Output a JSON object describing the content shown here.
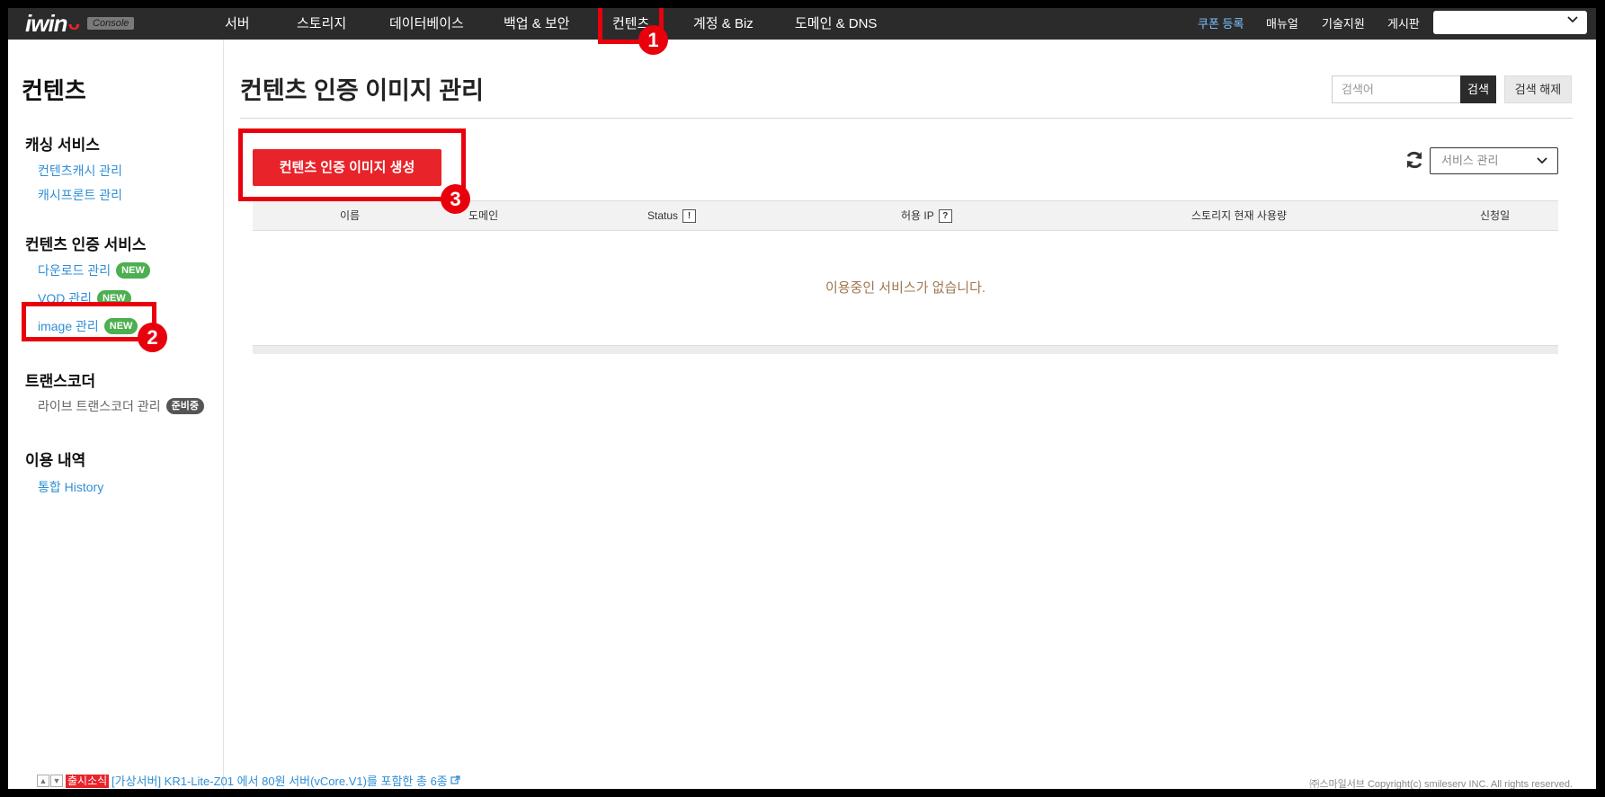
{
  "app": {
    "logo": "iwin",
    "logo_badge": "Console"
  },
  "topnav": {
    "items": [
      {
        "label": "서버"
      },
      {
        "label": "스토리지"
      },
      {
        "label": "데이터베이스"
      },
      {
        "label": "백업 & 보안"
      },
      {
        "label": "컨텐츠"
      },
      {
        "label": "계정 & Biz"
      },
      {
        "label": "도메인 & DNS"
      }
    ],
    "right": {
      "coupon": "쿠폰 등록",
      "manual": "매뉴얼",
      "support": "기술지원",
      "board": "게시판"
    },
    "account_select": "",
    "coupon_color": "#7fc3ff"
  },
  "sidebar": {
    "title": "컨텐츠",
    "groups": [
      {
        "title": "캐싱 서비스",
        "items": [
          {
            "label": "컨텐츠캐시 관리"
          },
          {
            "label": "캐시프론트 관리"
          }
        ]
      },
      {
        "title": "컨텐츠 인증 서비스",
        "items": [
          {
            "label": "다운로드 관리",
            "badge": "NEW"
          },
          {
            "label": "VOD 관리",
            "badge": "NEW"
          },
          {
            "label": "image 관리",
            "badge": "NEW"
          }
        ]
      },
      {
        "title": "트랜스코더",
        "items": [
          {
            "label": "라이브 트랜스코더 관리",
            "badge": "준비중"
          }
        ]
      },
      {
        "title": "이용 내역",
        "items": [
          {
            "label": "통합 History"
          }
        ]
      }
    ]
  },
  "main": {
    "title": "컨텐츠 인증 이미지 관리",
    "search": {
      "placeholder": "검색어",
      "button": "검색",
      "reset": "검색 해제"
    },
    "create_button": "컨텐츠 인증 이미지 생성",
    "service_select": "서비스 관리",
    "table": {
      "columns": [
        {
          "label": "이름"
        },
        {
          "label": "도메인"
        },
        {
          "label": "Status",
          "icon": "!"
        },
        {
          "label": "허용 IP",
          "icon": "?"
        },
        {
          "label": "스토리지 현재 사용량"
        },
        {
          "label": "신청일"
        }
      ],
      "empty_message": "이용중인 서비스가 없습니다."
    }
  },
  "footer": {
    "tag": "출시소식",
    "news": "[가상서버] KR1-Lite-Z01 에서 80원 서버(vCore.V1)를 포함한 총 6종",
    "copyright": "㈜스마일서브 Copyright(c) smileserv INC. All rights reserved."
  },
  "annotations": [
    "1",
    "2",
    "3"
  ],
  "colors": {
    "accent": "#e8232a",
    "link": "#2f8fd6",
    "nav_bg": "#2b2b2b",
    "badge_new": "#4caf50",
    "annotation": "#e8000d"
  }
}
